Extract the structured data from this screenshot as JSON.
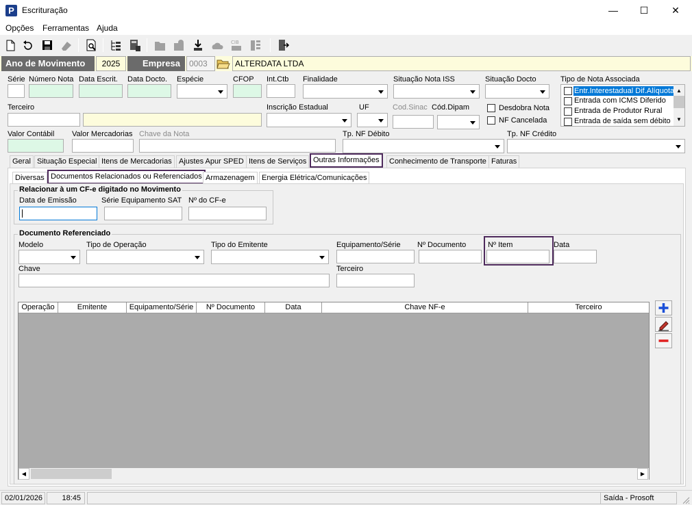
{
  "window": {
    "title": "Escrituração",
    "app_icon": "P"
  },
  "menu": {
    "items": [
      "Opções",
      "Ferramentas",
      "Ajuda"
    ]
  },
  "header": {
    "ano_label": "Ano de Movimento",
    "ano_value": "2025",
    "empresa_label": "Empresa",
    "empresa_code": "0003",
    "empresa_name": "ALTERDATA LTDA"
  },
  "form": {
    "serie": "Série",
    "numero_nota": "Número Nota",
    "data_escrit": "Data Escrit.",
    "data_docto": "Data Docto.",
    "especie": "Espécie",
    "cfop": "CFOP",
    "int_ctb": "Int.Ctb",
    "finalidade": "Finalidade",
    "situacao_iss": "Situação Nota ISS",
    "situacao_docto": "Situação Docto",
    "tipo_nota_assoc": "Tipo de Nota Associada",
    "tipo_nota_options": [
      "Entr.Interestadual Dif.Alíquota",
      "Entrada com ICMS Diferido",
      "Entrada de Produtor Rural",
      "Entrada de saída sem débito"
    ],
    "terceiro": "Terceiro",
    "inscricao_estadual": "Inscrição Estadual",
    "uf": "UF",
    "cod_sinac": "Cod.Sinac",
    "cod_dipam": "Cód.Dipam",
    "desdobra_nota": "Desdobra Nota",
    "nf_cancelada": "NF Cancelada",
    "valor_contabil": "Valor Contábil",
    "valor_mercadorias": "Valor Mercadorias",
    "chave_nota": "Chave da Nota",
    "tp_nf_debito": "Tp. NF Débito",
    "tp_nf_credito": "Tp. NF Crédito"
  },
  "tabs": [
    "Geral",
    "Situação Especial",
    "Itens de Mercadorias",
    "Ajustes Apur SPED",
    "Itens de Serviços",
    "Outras Informações",
    "Conhecimento de Transporte",
    "Faturas"
  ],
  "subtabs": [
    "Diversas",
    "Documentos Relacionados ou Referenciados",
    "Armazenagem",
    "Energia Elétrica/Comunicações"
  ],
  "cfe_group": {
    "title": "Relacionar à um CF-e digitado no Movimento",
    "data_emissao": "Data de Emissão",
    "serie_sat": "Série Equipamento SAT",
    "n_cfe": "Nº do CF-e"
  },
  "docref_group": {
    "title": "Documento Referenciado",
    "modelo": "Modelo",
    "tipo_operacao": "Tipo de Operação",
    "tipo_emitente": "Tipo do Emitente",
    "equip_serie": "Equipamento/Série",
    "n_documento": "Nº Documento",
    "n_item": "Nº Item",
    "data": "Data",
    "chave": "Chave",
    "terceiro": "Terceiro"
  },
  "grid": {
    "columns": [
      "Operação",
      "Emitente",
      "Equipamento/Série",
      "Nº Documento",
      "Data",
      "Chave NF-e",
      "Terceiro"
    ]
  },
  "status": {
    "date": "02/01/2026",
    "time": "18:45",
    "mode": "Saída - Prosoft"
  },
  "colors": {
    "purple_highlight": "#4e2a5c",
    "selected_option": "#0078d7",
    "green_field": "#ddf8e6",
    "yellow_field": "#fdfcdc"
  }
}
